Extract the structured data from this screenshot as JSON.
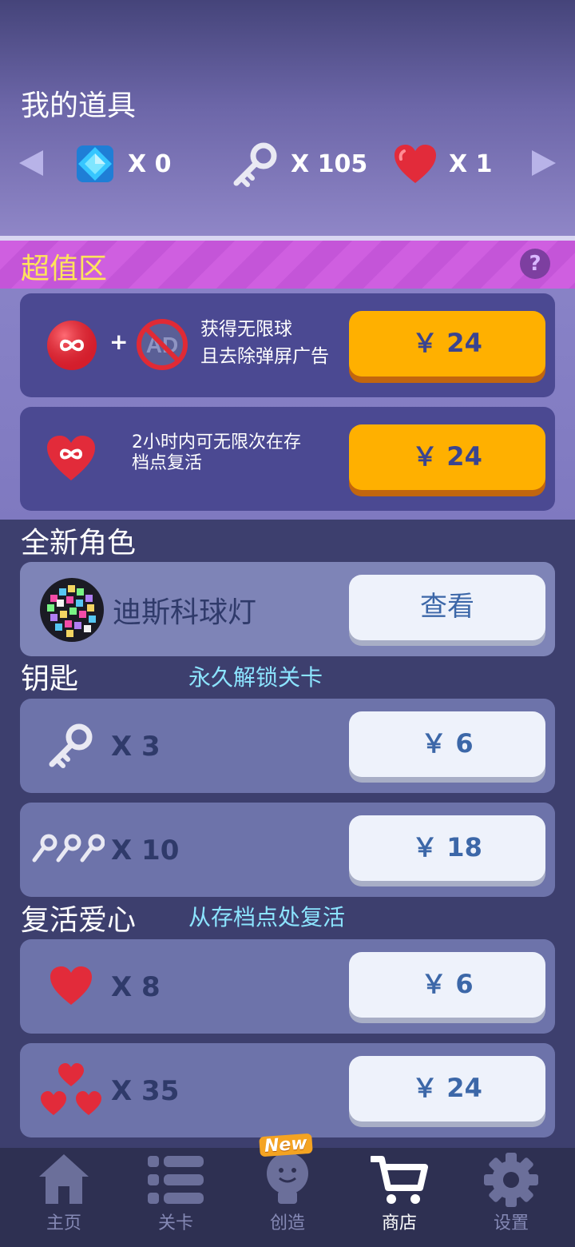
{
  "inventory": {
    "title": "我的道具",
    "gems": "X 0",
    "keys": "X 105",
    "hearts": "X 1"
  },
  "deal_zone": {
    "title": "超值区",
    "help": "?",
    "offer1": {
      "line1": "获得无限球",
      "line2": "且去除弹屏广告",
      "price": "￥ 24",
      "ad_label": "AD"
    },
    "offer2": {
      "line1": "2小时内可无限次在存",
      "line2": "档点复活",
      "price": "￥ 24"
    }
  },
  "characters": {
    "title": "全新角色",
    "item_name": "迪斯科球灯",
    "button": "查看"
  },
  "keys_section": {
    "title": "钥匙",
    "subtitle": "永久解锁关卡",
    "pack1": {
      "qty": "X 3",
      "price": "￥ 6"
    },
    "pack2": {
      "qty": "X 10",
      "price": "￥ 18"
    }
  },
  "hearts_section": {
    "title": "复活爱心",
    "subtitle": "从存档点处复活",
    "pack1": {
      "qty": "X 8",
      "price": "￥ 6"
    },
    "pack2": {
      "qty": "X 35",
      "price": "￥ 24"
    }
  },
  "tabs": [
    {
      "label": "主页",
      "icon": "home-icon"
    },
    {
      "label": "关卡",
      "icon": "list-icon"
    },
    {
      "label": "创造",
      "icon": "lightbulb-icon"
    },
    {
      "label": "商店",
      "icon": "cart-icon",
      "active": true
    },
    {
      "label": "设置",
      "icon": "gear-icon"
    }
  ],
  "new_badge": "New",
  "colors": {
    "gold_button": "#ffb000",
    "white_button": "#eef2fb",
    "price_text": "#3c67a8",
    "subtitle": "#8ce4ff",
    "deal_title": "#ffe45a"
  }
}
